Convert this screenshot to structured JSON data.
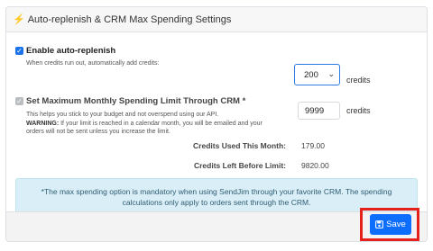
{
  "header": {
    "icon": "bolt-icon",
    "title": "Auto-replenish & CRM Max Spending Settings"
  },
  "auto_replenish": {
    "checked": true,
    "label": "Enable auto-replenish",
    "help": "When credits run out, automatically add credits:",
    "amount_value": "200",
    "amount_unit": "credits"
  },
  "spending_limit": {
    "checked": true,
    "disabled": true,
    "label": "Set Maximum Monthly Spending Limit Through CRM *",
    "help": "This helps you stick to your budget and not overspend using our API.",
    "warning_label": "WARNING:",
    "warning_text": " If your limit is reached in a calendar month, you will be emailed and your orders will not be sent unless you increase the limit.",
    "limit_value": "9999",
    "limit_unit": "credits"
  },
  "stats": {
    "used_label": "Credits Used This Month:",
    "used_value": "179.00",
    "left_label": "Credits Left Before Limit:",
    "left_value": "9820.00"
  },
  "info_note": "*The max spending option is mandatory when using SendJim through your favorite CRM. The spending calculations only apply to orders sent through the CRM.",
  "footer": {
    "save_label": "Save",
    "save_icon": "floppy-disk-icon"
  },
  "colors": {
    "primary": "#0d6efd",
    "highlight": "#e5211b",
    "info_bg": "#d9eef7"
  }
}
